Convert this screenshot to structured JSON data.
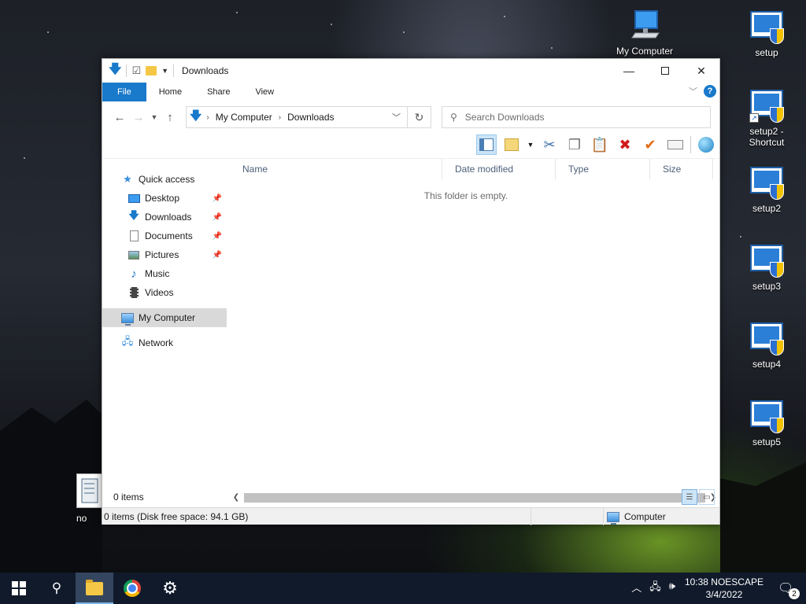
{
  "desktop": {
    "icons": [
      {
        "label": "My Computer"
      },
      {
        "label": "setup"
      },
      {
        "label": "setup2 - Shortcut"
      },
      {
        "label": "setup2"
      },
      {
        "label": "setup3"
      },
      {
        "label": "setup4"
      },
      {
        "label": "setup5"
      }
    ],
    "partial_icon_label": "no"
  },
  "window": {
    "title": "Downloads",
    "ribbon_tabs": [
      "File",
      "Home",
      "Share",
      "View"
    ],
    "help_label": "?",
    "address": {
      "crumbs": [
        "My Computer",
        "Downloads"
      ]
    },
    "search": {
      "placeholder": "Search Downloads"
    },
    "nav_pane": {
      "quick_access": "Quick access",
      "items": [
        {
          "label": "Desktop",
          "icon": "desktop-icon",
          "pinned": true
        },
        {
          "label": "Downloads",
          "icon": "download-arrow-icon",
          "pinned": true
        },
        {
          "label": "Documents",
          "icon": "documents-icon",
          "pinned": true
        },
        {
          "label": "Pictures",
          "icon": "pictures-icon",
          "pinned": true
        },
        {
          "label": "Music",
          "icon": "music-note-icon",
          "pinned": false
        },
        {
          "label": "Videos",
          "icon": "film-icon",
          "pinned": false
        }
      ],
      "my_computer": "My Computer",
      "network": "Network"
    },
    "columns": [
      "Name",
      "Date modified",
      "Type",
      "Size"
    ],
    "empty_message": "This folder is empty.",
    "status_items": "0 items",
    "bottom_status": "0 items (Disk free space: 94.1 GB)",
    "bottom_location": "Computer"
  },
  "taskbar": {
    "time_label": "10:38 NOESCAPE",
    "date": "3/4/2022",
    "notification_count": "2"
  },
  "colors": {
    "accent": "#1979ca",
    "taskbar": "#101a2b"
  }
}
